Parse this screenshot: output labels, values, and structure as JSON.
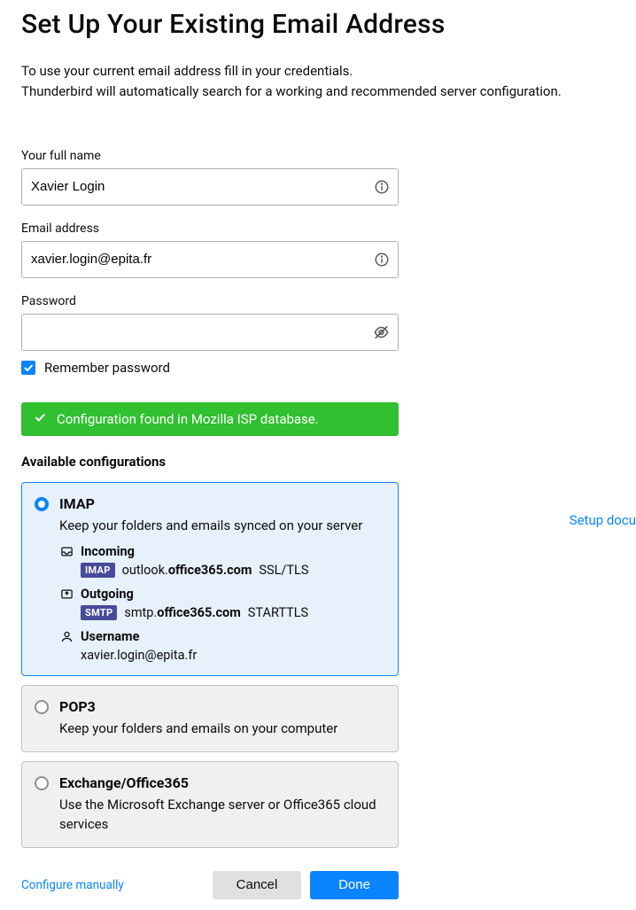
{
  "title": "Set Up Your Existing Email Address",
  "intro_line1": "To use your current email address fill in your credentials.",
  "intro_line2": "Thunderbird will automatically search for a working and recommended server configuration.",
  "fields": {
    "name_label": "Your full name",
    "name_value": "Xavier Login",
    "email_label": "Email address",
    "email_value": "xavier.login@epita.fr",
    "password_label": "Password",
    "password_value": "",
    "remember_label": "Remember password",
    "remember_checked": true
  },
  "status": {
    "text": "Configuration found in Mozilla ISP database."
  },
  "available_label": "Available configurations",
  "configs": {
    "imap": {
      "title": "IMAP",
      "desc": "Keep your folders and emails synced on your server",
      "incoming_label": "Incoming",
      "incoming_proto": "IMAP",
      "incoming_host_prefix": "outlook.",
      "incoming_host_bold": "office365.com",
      "incoming_security": "SSL/TLS",
      "outgoing_label": "Outgoing",
      "outgoing_proto": "SMTP",
      "outgoing_host_prefix": "smtp.",
      "outgoing_host_bold": "office365.com",
      "outgoing_security": "STARTTLS",
      "username_label": "Username",
      "username_value": "xavier.login@epita.fr"
    },
    "pop3": {
      "title": "POP3",
      "desc": "Keep your folders and emails on your computer"
    },
    "exchange": {
      "title": "Exchange/Office365",
      "desc": "Use the Microsoft Exchange server or Office365 cloud services"
    }
  },
  "buttons": {
    "configure_manually": "Configure manually",
    "cancel": "Cancel",
    "done": "Done"
  },
  "side_link": "Setup docu"
}
